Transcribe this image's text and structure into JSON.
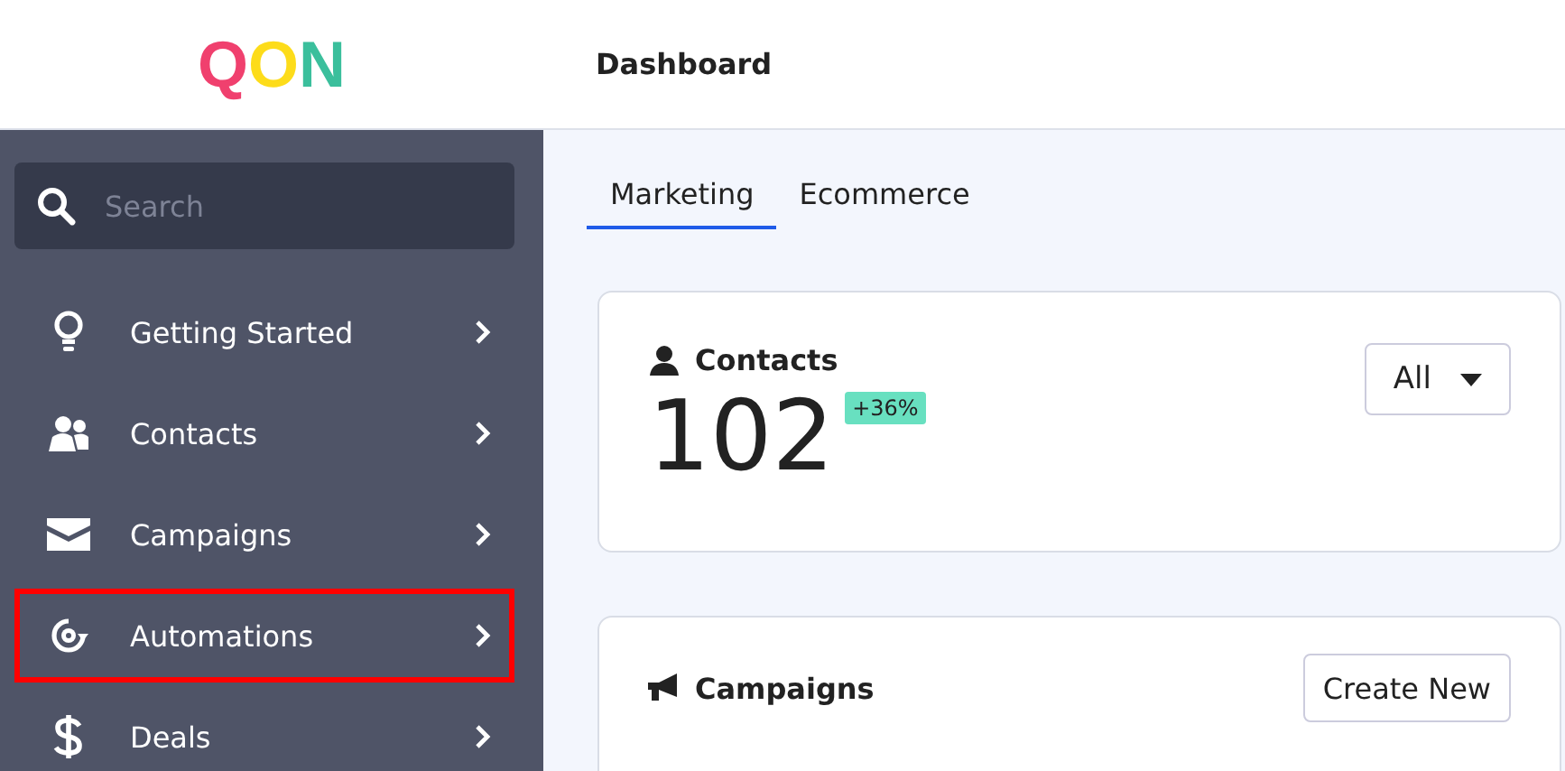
{
  "logo": [
    {
      "char": "Q",
      "color": "#f0406e"
    },
    {
      "char": "O",
      "color": "#fddc1a"
    },
    {
      "char": "N",
      "color": "#3bbf9c"
    }
  ],
  "header": {
    "title": "Dashboard"
  },
  "search": {
    "placeholder": "Search"
  },
  "sidebar": {
    "items": [
      {
        "label": "Getting Started",
        "kind": "bulb",
        "highlighted": false
      },
      {
        "label": "Contacts",
        "kind": "people",
        "highlighted": false
      },
      {
        "label": "Campaigns",
        "kind": "mail",
        "highlighted": false
      },
      {
        "label": "Automations",
        "kind": "gear",
        "highlighted": true
      },
      {
        "label": "Deals",
        "kind": "dollar",
        "highlighted": false
      }
    ]
  },
  "tabs": [
    {
      "label": "Marketing",
      "selected": true
    },
    {
      "label": "Ecommerce",
      "selected": false
    }
  ],
  "contacts_card": {
    "title": "Contacts",
    "filter": "All",
    "count": "102",
    "change": "+36%"
  },
  "campaigns_card": {
    "title": "Campaigns",
    "button": "Create New"
  }
}
